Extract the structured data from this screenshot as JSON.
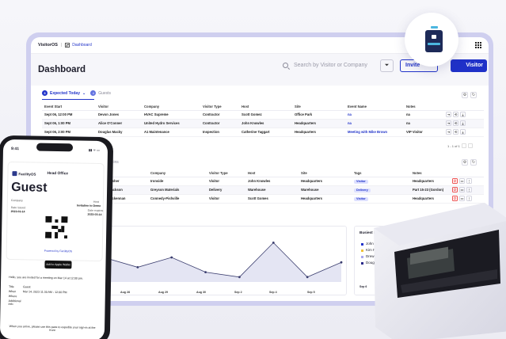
{
  "topbar": {
    "brand": "VisitorOS",
    "sep": "|",
    "crumb": "Dashboard"
  },
  "header": {
    "title": "Dashboard",
    "search_placeholder": "Search by Visitor or Company",
    "invite_label": "Invite",
    "visitor_label": "Visitor"
  },
  "tabs": [
    {
      "count": "3",
      "label": "Expected Today",
      "chevron": "⌄"
    },
    {
      "count": "4",
      "label": "Guests"
    }
  ],
  "expected_table": {
    "columns": [
      "Event Start",
      "Visitor",
      "Company",
      "Visitor Type",
      "Host",
      "Site",
      "Event Name",
      "Notes"
    ],
    "rows": [
      [
        "Sept 06, 12:00 PM",
        "Devon Jones",
        "HVAC Supreme",
        "Contractor",
        "Scott Gomez",
        "Office Park",
        "na",
        "na"
      ],
      [
        "Sept 06, 1:00 PM",
        "Alice O'Conner",
        "United Hydro Services",
        "Contractor",
        "John Knowles",
        "Headquarters",
        "na",
        "na"
      ],
      [
        "Sept 06, 2:00 PM",
        "Douglas Macky",
        "A1 Maintenance",
        "Inspection",
        "Catherine Taggart",
        "Headquarters",
        "Meeting with Mike Brown",
        "VIP Visitor"
      ]
    ],
    "pager": "1 - 1 of 1"
  },
  "signin_tab_label": "ign-ins",
  "signin_table": {
    "columns": [
      "Company",
      "Visitor Type",
      "Host",
      "Site",
      "Tags",
      "Notes"
    ],
    "rows": [
      [
        "Fisher",
        "Ironside",
        "Visitor",
        "John Knowles",
        "Headquarters",
        "Visitor",
        "Headquarters"
      ],
      [
        "Jackson",
        "Greyson Materials",
        "Delivery",
        "Warehouse",
        "Warehouse",
        "Delivery",
        "Part 15-23 (Gordon)"
      ],
      [
        "Mckennan",
        "Connedy-Pishville",
        "Visitor",
        "Scott Gomes",
        "Headquarters",
        "Visitor",
        "Headquarters"
      ]
    ]
  },
  "chart_data": {
    "type": "line",
    "categories": [
      "Aug 27",
      "Aug 28",
      "Aug 29",
      "Aug 30",
      "Sep 2",
      "Sep 4",
      "Sep 5"
    ],
    "values": [
      5,
      3,
      5,
      2,
      1,
      8,
      1,
      4
    ],
    "ylim": [
      0,
      10
    ]
  },
  "busiest": {
    "title": "Busiest Hos",
    "items": [
      {
        "label": "John G",
        "color": "#2133c9"
      },
      {
        "label": "Kim Pe",
        "color": "#f0c23a"
      },
      {
        "label": "Drew S",
        "color": "#a7a7f0"
      },
      {
        "label": "Doug I",
        "color": "#2a2a8a"
      }
    ],
    "tick": "Sep 6"
  },
  "phone": {
    "time": "9:41",
    "status_right": "▮▮ ᯤ ▭",
    "brand": "FacilityOS",
    "office": "Head Office",
    "guest": "Guest",
    "company_label": "Company",
    "host_label": "Host",
    "host_value": "Invitation to Demo",
    "date_label": "Date issued",
    "date_value": "2023-03-14",
    "expiry_label": "Date expires",
    "expiry_value": "2023-03-14",
    "powered": "Powered by FacilityOS",
    "wallet": "Add to Apple Wallet",
    "intro": "Hello, you are invited for a meeting on Mar 14 at 12:00 pm.",
    "details": [
      [
        "Title",
        "Guest"
      ],
      [
        "When",
        "Mar 14, 2023 11:30 AM - 12:00 PM"
      ],
      [
        "Where",
        ""
      ],
      [
        "Additional Info",
        ""
      ]
    ],
    "footer": "When you arrive, please use this pass to expedite your sign-in at the front"
  }
}
